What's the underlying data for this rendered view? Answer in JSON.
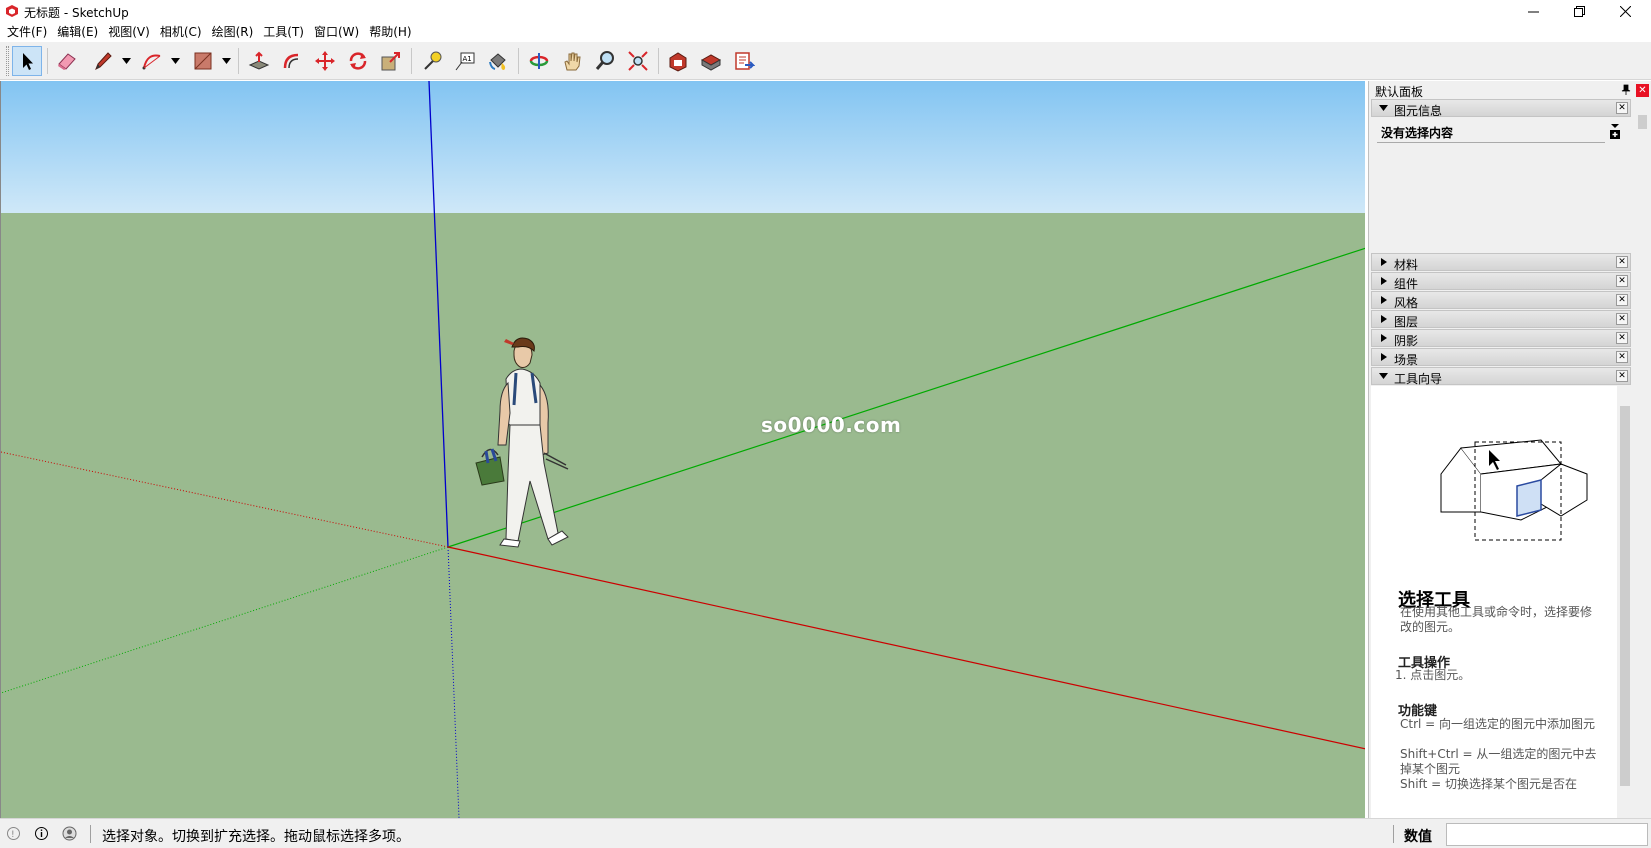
{
  "window": {
    "title": "无标题 - SketchUp"
  },
  "menu": {
    "items": [
      "文件(F)",
      "编辑(E)",
      "视图(V)",
      "相机(C)",
      "绘图(R)",
      "工具(T)",
      "窗口(W)",
      "帮助(H)"
    ]
  },
  "toolbar": {
    "tools": [
      {
        "name": "select-tool",
        "icon": "arrow-cursor-icon",
        "active": true
      },
      {
        "name": "eraser-tool",
        "icon": "eraser-icon"
      },
      {
        "name": "pencil-tool",
        "icon": "pencil-icon"
      },
      {
        "name": "arc-tool",
        "icon": "arc-icon"
      },
      {
        "name": "rectangle-tool",
        "icon": "rectangle-icon"
      },
      {
        "name": "push-pull-tool",
        "icon": "push-pull-icon"
      },
      {
        "name": "offset-tool",
        "icon": "offset-icon"
      },
      {
        "name": "move-tool",
        "icon": "move-icon"
      },
      {
        "name": "rotate-tool",
        "icon": "rotate-icon"
      },
      {
        "name": "scale-tool",
        "icon": "scale-icon"
      },
      {
        "name": "tape-measure-tool",
        "icon": "tape-measure-icon"
      },
      {
        "name": "text-tool",
        "icon": "text-icon"
      },
      {
        "name": "paint-bucket-tool",
        "icon": "paint-bucket-icon"
      },
      {
        "name": "orbit-tool",
        "icon": "orbit-icon"
      },
      {
        "name": "pan-tool",
        "icon": "hand-icon"
      },
      {
        "name": "zoom-tool",
        "icon": "magnifier-icon"
      },
      {
        "name": "zoom-extents-tool",
        "icon": "zoom-extents-icon"
      },
      {
        "name": "warehouse-tool",
        "icon": "warehouse-icon"
      },
      {
        "name": "extension-warehouse-tool",
        "icon": "extension-warehouse-icon"
      },
      {
        "name": "send-to-layout-tool",
        "icon": "send-to-layout-icon"
      }
    ]
  },
  "viewport": {
    "watermark": "so0000.com",
    "sky_color": "#a8d4f2",
    "ground_color": "#9aba8f"
  },
  "tray": {
    "title": "默认面板",
    "entity_info": {
      "label": "图元信息",
      "content": "没有选择内容"
    },
    "panels": [
      "材料",
      "组件",
      "风格",
      "图层",
      "阴影",
      "场景"
    ],
    "instructor": {
      "label": "工具向导",
      "tool_title": "选择工具",
      "description": "在使用其他工具或命令时，选择要修改的图元。",
      "operations_heading": "工具操作",
      "operations_step": "1.    点击图元。",
      "keys_heading": "功能键",
      "key_ctrl": "Ctrl = 向一组选定的图元中添加图元",
      "key_shift_ctrl": "Shift+Ctrl = 从一组选定的图元中去掉某个图元",
      "key_shift": "Shift = 切换选择某个图元是否在"
    }
  },
  "status": {
    "message": "选择对象。切换到扩充选择。拖动鼠标选择多项。",
    "measurements_label": "数值",
    "measurements_value": ""
  },
  "colors": {
    "accent": "#cce4f7",
    "close_red": "#e81123",
    "axis_red": "#cc0000",
    "axis_green": "#00aa00",
    "axis_blue": "#0000cc"
  }
}
